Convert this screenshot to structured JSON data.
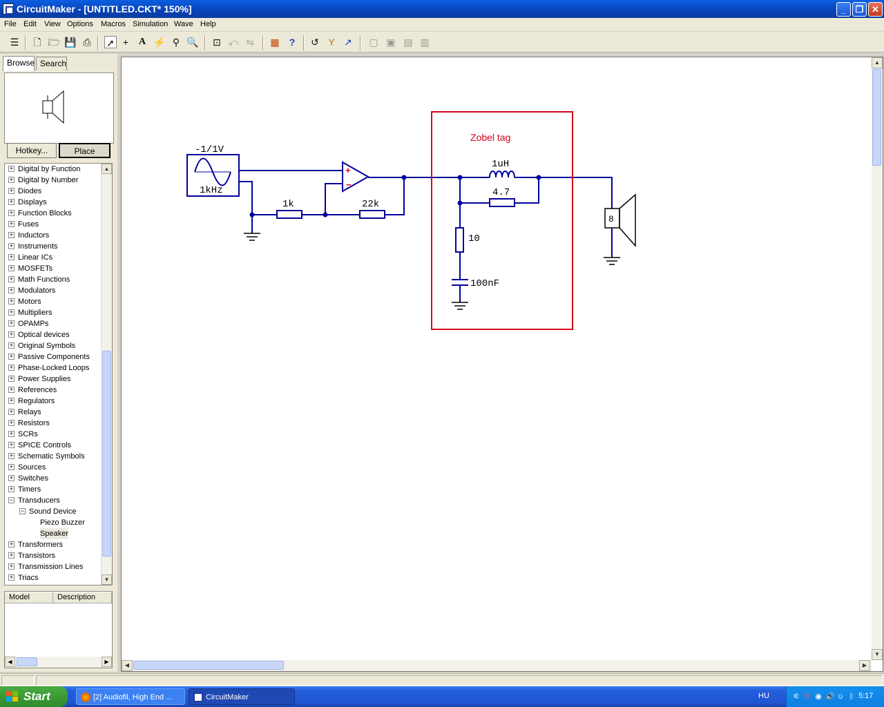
{
  "window": {
    "title": "CircuitMaker - [UNTITLED.CKT* 150%]"
  },
  "menu": [
    "File",
    "Edit",
    "View",
    "Options",
    "Macros",
    "Simulation",
    "Wave",
    "Help"
  ],
  "toolbar_icons": [
    "arrange-icon",
    "new-icon",
    "open-icon",
    "save-icon",
    "print-icon",
    "arrow-icon",
    "wire-icon",
    "text-icon",
    "probe-icon",
    "paint-icon",
    "zoom-icon",
    "fit-icon",
    "rotate-icon",
    "mirror-icon",
    "netlist-icon",
    "help-icon",
    "undo-icon",
    "wizard-icon",
    "simulate-icon"
  ],
  "panel": {
    "tabs": [
      "Browse",
      "Search"
    ],
    "hotkey_label": "Hotkey...",
    "place_label": "Place",
    "tree": [
      {
        "label": "Digital by Function",
        "level": 0,
        "expander": "+"
      },
      {
        "label": "Digital by Number",
        "level": 0,
        "expander": "+"
      },
      {
        "label": "Diodes",
        "level": 0,
        "expander": "+"
      },
      {
        "label": "Displays",
        "level": 0,
        "expander": "+"
      },
      {
        "label": "Function Blocks",
        "level": 0,
        "expander": "+"
      },
      {
        "label": "Fuses",
        "level": 0,
        "expander": "+"
      },
      {
        "label": "Inductors",
        "level": 0,
        "expander": "+"
      },
      {
        "label": "Instruments",
        "level": 0,
        "expander": "+"
      },
      {
        "label": "Linear ICs",
        "level": 0,
        "expander": "+"
      },
      {
        "label": "MOSFETs",
        "level": 0,
        "expander": "+"
      },
      {
        "label": "Math Functions",
        "level": 0,
        "expander": "+"
      },
      {
        "label": "Modulators",
        "level": 0,
        "expander": "+"
      },
      {
        "label": "Motors",
        "level": 0,
        "expander": "+"
      },
      {
        "label": "Multipliers",
        "level": 0,
        "expander": "+"
      },
      {
        "label": "OPAMPs",
        "level": 0,
        "expander": "+"
      },
      {
        "label": "Optical devices",
        "level": 0,
        "expander": "+"
      },
      {
        "label": "Original Symbols",
        "level": 0,
        "expander": "+"
      },
      {
        "label": "Passive Components",
        "level": 0,
        "expander": "+"
      },
      {
        "label": "Phase-Locked Loops",
        "level": 0,
        "expander": "+"
      },
      {
        "label": "Power Supplies",
        "level": 0,
        "expander": "+"
      },
      {
        "label": "References",
        "level": 0,
        "expander": "+"
      },
      {
        "label": "Regulators",
        "level": 0,
        "expander": "+"
      },
      {
        "label": "Relays",
        "level": 0,
        "expander": "+"
      },
      {
        "label": "Resistors",
        "level": 0,
        "expander": "+"
      },
      {
        "label": "SCRs",
        "level": 0,
        "expander": "+"
      },
      {
        "label": "SPICE Controls",
        "level": 0,
        "expander": "+"
      },
      {
        "label": "Schematic Symbols",
        "level": 0,
        "expander": "+"
      },
      {
        "label": "Sources",
        "level": 0,
        "expander": "+"
      },
      {
        "label": "Switches",
        "level": 0,
        "expander": "+"
      },
      {
        "label": "Timers",
        "level": 0,
        "expander": "+"
      },
      {
        "label": "Transducers",
        "level": 0,
        "expander": "−"
      },
      {
        "label": "Sound Device",
        "level": 1,
        "expander": "−"
      },
      {
        "label": "Piezo Buzzer",
        "level": 2,
        "expander": ""
      },
      {
        "label": "Speaker",
        "level": 2,
        "expander": "",
        "selected": true
      },
      {
        "label": "Transformers",
        "level": 0,
        "expander": "+"
      },
      {
        "label": "Transistors",
        "level": 0,
        "expander": "+"
      },
      {
        "label": "Transmission Lines",
        "level": 0,
        "expander": "+"
      },
      {
        "label": "Triacs",
        "level": 0,
        "expander": "+"
      }
    ],
    "columns": [
      "Model",
      "Description"
    ]
  },
  "schematic": {
    "source_label": "-1/1V",
    "source_freq": "1kHz",
    "r1": "1k",
    "r2": "22k",
    "zobel_title": "Zobel tag",
    "inductor": "1uH",
    "r_parallel": "4.7",
    "r_zobel": "10",
    "c_zobel": "100nF",
    "speaker": "8",
    "wire_color": "#00009c",
    "box_color": "#d4001a"
  },
  "taskbar": {
    "start_label": "Start",
    "items": [
      "[2] Audiofil, High End ...",
      "CircuitMaker"
    ],
    "language": "HU",
    "clock": "5:17"
  }
}
